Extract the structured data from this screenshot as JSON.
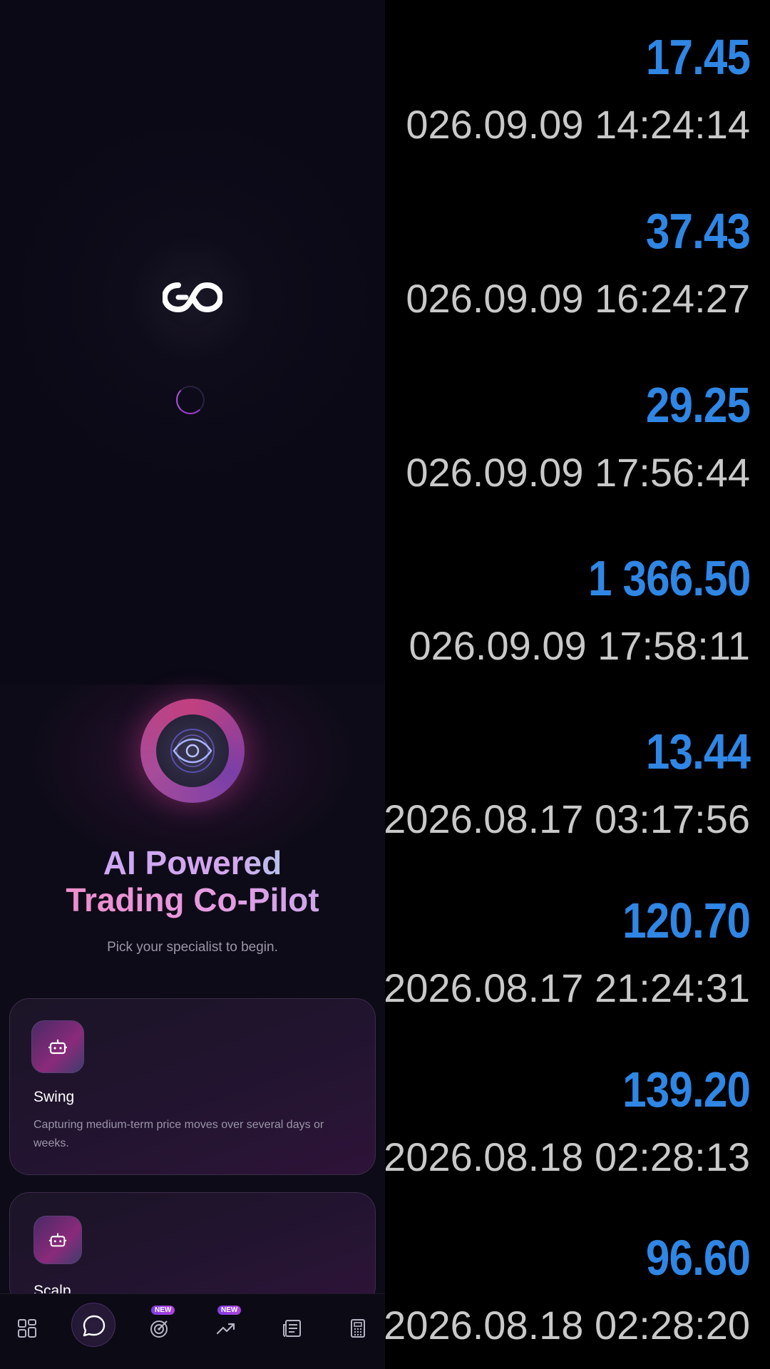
{
  "splash": {
    "logo_icon": "infinity-go-logo-icon",
    "spinner_icon": "loading-spinner-icon"
  },
  "home": {
    "hero_icon": "eye-orb-icon",
    "headline_line1": "AI Powered",
    "headline_line2": "Trading Co-Pilot",
    "subtitle": "Pick your specialist to begin.",
    "cards": [
      {
        "icon": "robot-icon",
        "title": "Swing",
        "description": "Capturing medium-term price moves over several days or weeks."
      },
      {
        "icon": "robot-icon",
        "title": "Scalp"
      }
    ]
  },
  "navbar": {
    "items": [
      {
        "icon": "dashboard-grid-icon",
        "active": false
      },
      {
        "icon": "chat-bubble-icon",
        "active": true
      },
      {
        "icon": "target-icon",
        "badge": "NEW"
      },
      {
        "icon": "trending-up-icon",
        "badge": "NEW"
      },
      {
        "icon": "news-icon",
        "active": false
      },
      {
        "icon": "calculator-icon",
        "active": false
      }
    ]
  },
  "trades": [
    {
      "amount": "17.45",
      "timestamp": "026.09.09 14:24:14"
    },
    {
      "amount": "37.43",
      "timestamp": "026.09.09 16:24:27"
    },
    {
      "amount": "29.25",
      "timestamp": "026.09.09 17:56:44"
    },
    {
      "amount": "1 366.50",
      "timestamp": "026.09.09 17:58:11"
    },
    {
      "amount": "13.44",
      "timestamp": "2026.08.17 03:17:56"
    },
    {
      "amount": "120.70",
      "timestamp": "2026.08.17 21:24:31"
    },
    {
      "amount": "139.20",
      "timestamp": "2026.08.18 02:28:13"
    },
    {
      "amount": "96.60",
      "timestamp": "2026.08.18 02:28:20"
    }
  ],
  "colors": {
    "amount": "#2f86e4",
    "timestamp": "#c9c9c9",
    "accent": "#b240e0"
  }
}
